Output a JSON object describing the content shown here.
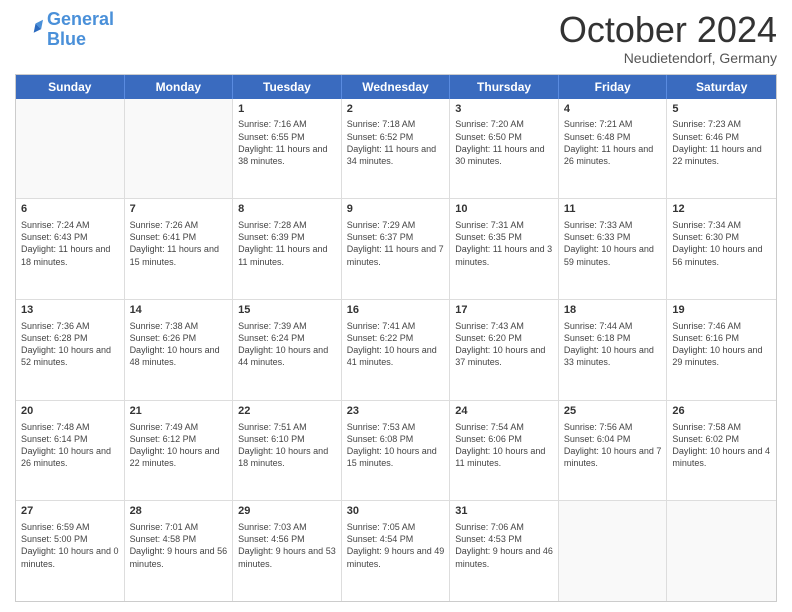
{
  "header": {
    "logo_line1": "General",
    "logo_line2": "Blue",
    "month": "October 2024",
    "location": "Neudietendorf, Germany"
  },
  "weekdays": [
    "Sunday",
    "Monday",
    "Tuesday",
    "Wednesday",
    "Thursday",
    "Friday",
    "Saturday"
  ],
  "rows": [
    [
      {
        "day": "",
        "info": ""
      },
      {
        "day": "",
        "info": ""
      },
      {
        "day": "1",
        "info": "Sunrise: 7:16 AM\nSunset: 6:55 PM\nDaylight: 11 hours and 38 minutes."
      },
      {
        "day": "2",
        "info": "Sunrise: 7:18 AM\nSunset: 6:52 PM\nDaylight: 11 hours and 34 minutes."
      },
      {
        "day": "3",
        "info": "Sunrise: 7:20 AM\nSunset: 6:50 PM\nDaylight: 11 hours and 30 minutes."
      },
      {
        "day": "4",
        "info": "Sunrise: 7:21 AM\nSunset: 6:48 PM\nDaylight: 11 hours and 26 minutes."
      },
      {
        "day": "5",
        "info": "Sunrise: 7:23 AM\nSunset: 6:46 PM\nDaylight: 11 hours and 22 minutes."
      }
    ],
    [
      {
        "day": "6",
        "info": "Sunrise: 7:24 AM\nSunset: 6:43 PM\nDaylight: 11 hours and 18 minutes."
      },
      {
        "day": "7",
        "info": "Sunrise: 7:26 AM\nSunset: 6:41 PM\nDaylight: 11 hours and 15 minutes."
      },
      {
        "day": "8",
        "info": "Sunrise: 7:28 AM\nSunset: 6:39 PM\nDaylight: 11 hours and 11 minutes."
      },
      {
        "day": "9",
        "info": "Sunrise: 7:29 AM\nSunset: 6:37 PM\nDaylight: 11 hours and 7 minutes."
      },
      {
        "day": "10",
        "info": "Sunrise: 7:31 AM\nSunset: 6:35 PM\nDaylight: 11 hours and 3 minutes."
      },
      {
        "day": "11",
        "info": "Sunrise: 7:33 AM\nSunset: 6:33 PM\nDaylight: 10 hours and 59 minutes."
      },
      {
        "day": "12",
        "info": "Sunrise: 7:34 AM\nSunset: 6:30 PM\nDaylight: 10 hours and 56 minutes."
      }
    ],
    [
      {
        "day": "13",
        "info": "Sunrise: 7:36 AM\nSunset: 6:28 PM\nDaylight: 10 hours and 52 minutes."
      },
      {
        "day": "14",
        "info": "Sunrise: 7:38 AM\nSunset: 6:26 PM\nDaylight: 10 hours and 48 minutes."
      },
      {
        "day": "15",
        "info": "Sunrise: 7:39 AM\nSunset: 6:24 PM\nDaylight: 10 hours and 44 minutes."
      },
      {
        "day": "16",
        "info": "Sunrise: 7:41 AM\nSunset: 6:22 PM\nDaylight: 10 hours and 41 minutes."
      },
      {
        "day": "17",
        "info": "Sunrise: 7:43 AM\nSunset: 6:20 PM\nDaylight: 10 hours and 37 minutes."
      },
      {
        "day": "18",
        "info": "Sunrise: 7:44 AM\nSunset: 6:18 PM\nDaylight: 10 hours and 33 minutes."
      },
      {
        "day": "19",
        "info": "Sunrise: 7:46 AM\nSunset: 6:16 PM\nDaylight: 10 hours and 29 minutes."
      }
    ],
    [
      {
        "day": "20",
        "info": "Sunrise: 7:48 AM\nSunset: 6:14 PM\nDaylight: 10 hours and 26 minutes."
      },
      {
        "day": "21",
        "info": "Sunrise: 7:49 AM\nSunset: 6:12 PM\nDaylight: 10 hours and 22 minutes."
      },
      {
        "day": "22",
        "info": "Sunrise: 7:51 AM\nSunset: 6:10 PM\nDaylight: 10 hours and 18 minutes."
      },
      {
        "day": "23",
        "info": "Sunrise: 7:53 AM\nSunset: 6:08 PM\nDaylight: 10 hours and 15 minutes."
      },
      {
        "day": "24",
        "info": "Sunrise: 7:54 AM\nSunset: 6:06 PM\nDaylight: 10 hours and 11 minutes."
      },
      {
        "day": "25",
        "info": "Sunrise: 7:56 AM\nSunset: 6:04 PM\nDaylight: 10 hours and 7 minutes."
      },
      {
        "day": "26",
        "info": "Sunrise: 7:58 AM\nSunset: 6:02 PM\nDaylight: 10 hours and 4 minutes."
      }
    ],
    [
      {
        "day": "27",
        "info": "Sunrise: 6:59 AM\nSunset: 5:00 PM\nDaylight: 10 hours and 0 minutes."
      },
      {
        "day": "28",
        "info": "Sunrise: 7:01 AM\nSunset: 4:58 PM\nDaylight: 9 hours and 56 minutes."
      },
      {
        "day": "29",
        "info": "Sunrise: 7:03 AM\nSunset: 4:56 PM\nDaylight: 9 hours and 53 minutes."
      },
      {
        "day": "30",
        "info": "Sunrise: 7:05 AM\nSunset: 4:54 PM\nDaylight: 9 hours and 49 minutes."
      },
      {
        "day": "31",
        "info": "Sunrise: 7:06 AM\nSunset: 4:53 PM\nDaylight: 9 hours and 46 minutes."
      },
      {
        "day": "",
        "info": ""
      },
      {
        "day": "",
        "info": ""
      }
    ]
  ]
}
